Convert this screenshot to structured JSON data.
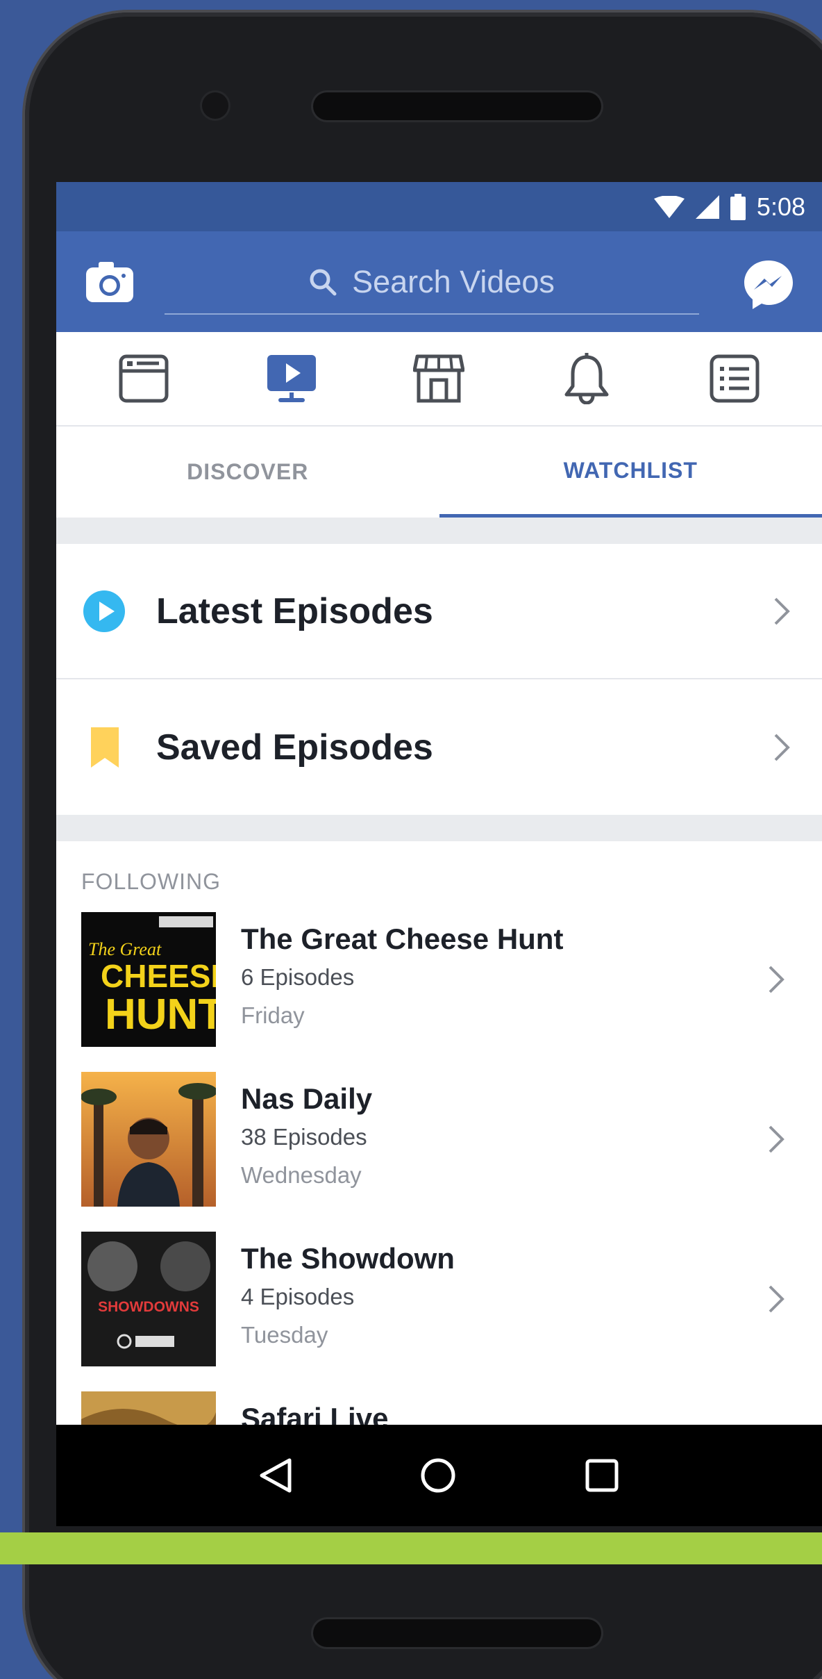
{
  "status_bar": {
    "time": "5:08"
  },
  "header": {
    "search_placeholder": "Search Videos"
  },
  "nav_icons": [
    "news-feed-icon",
    "watch-icon",
    "marketplace-icon",
    "notifications-icon",
    "menu-icon"
  ],
  "tabs": [
    {
      "label": "DISCOVER",
      "active": false
    },
    {
      "label": "WATCHLIST",
      "active": true
    }
  ],
  "menu": [
    {
      "label": "Latest Episodes",
      "icon": "play-circle-icon",
      "color": "#35b8f0"
    },
    {
      "label": "Saved Episodes",
      "icon": "bookmark-icon",
      "color": "#ffd25b"
    }
  ],
  "following": {
    "label": "FOLLOWING",
    "shows": [
      {
        "title": "The Great Cheese Hunt",
        "episodes": "6 Episodes",
        "day": "Friday"
      },
      {
        "title": "Nas Daily",
        "episodes": "38 Episodes",
        "day": "Wednesday"
      },
      {
        "title": "The Showdown",
        "episodes": "4 Episodes",
        "day": "Tuesday"
      },
      {
        "title": "Safari Live",
        "episodes": "",
        "day": ""
      }
    ]
  },
  "thumbnails": {
    "cheese_line1": "The Great",
    "cheese_line2": "CHEESE",
    "cheese_line3": "HUNT",
    "showdown": "SHOWDOWNS"
  },
  "colors": {
    "brand": "#4267b2",
    "status_bar": "#365899",
    "accent_green": "#a4cf45"
  }
}
